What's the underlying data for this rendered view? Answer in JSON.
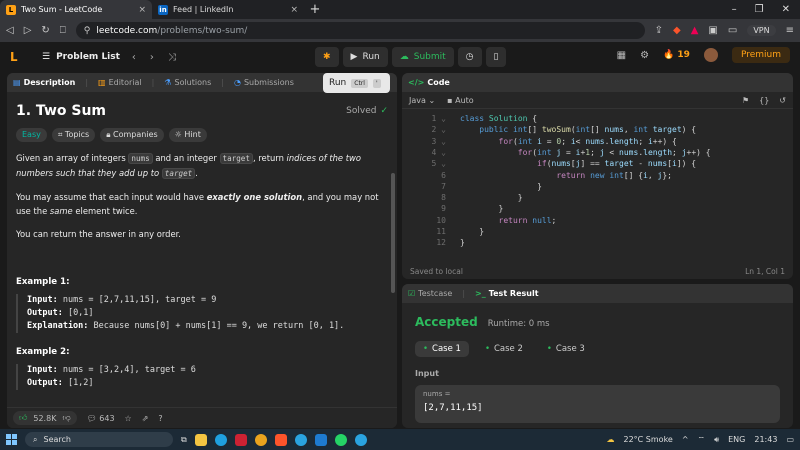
{
  "browser": {
    "tabs": [
      {
        "title": "Two Sum - LeetCode",
        "active": true
      },
      {
        "title": "Feed | LinkedIn",
        "active": false
      }
    ],
    "url_host": "leetcode.com",
    "url_path": "/problems/two-sum/",
    "vpn_label": "VPN"
  },
  "nav": {
    "problem_list": "Problem List",
    "run_label": "Run",
    "submit_label": "Submit",
    "streak": "19",
    "premium_label": "Premium"
  },
  "left_tabs": [
    "Description",
    "Editorial",
    "Solutions",
    "Submissions"
  ],
  "run_tooltip": {
    "label": "Run",
    "key1": "Ctrl",
    "key2": "'"
  },
  "problem": {
    "title": "1. Two Sum",
    "status": "Solved",
    "chips": [
      "Easy",
      "Topics",
      "Companies",
      "Hint"
    ],
    "para1_a": "Given an array of integers ",
    "para1_nums": "nums",
    "para1_b": " and an integer ",
    "para1_target": "target",
    "para1_c": ", return ",
    "para1_d": "indices of the two numbers such that they add up to",
    "para1_target2": "target",
    "para1_e": ".",
    "para2_a": "You may assume that each input would have ",
    "para2_b": "exactly one solution",
    "para2_c": ", and you may not use the ",
    "para2_d": "same",
    "para2_e": " element twice.",
    "para3": "You can return the answer in any order.",
    "examples": [
      {
        "heading": "Example 1:",
        "input_label": "Input:",
        "input": " nums = [2,7,11,15], target = 9",
        "output_label": "Output:",
        "output": " [0,1]",
        "expl_label": "Explanation:",
        "expl": " Because nums[0] + nums[1] == 9, we return [0, 1]."
      },
      {
        "heading": "Example 2:",
        "input_label": "Input:",
        "input": " nums = [3,2,4], target = 6",
        "output_label": "Output:",
        "output": " [1,2]"
      }
    ],
    "likes": "52.8K",
    "comments": "643"
  },
  "code": {
    "tab_label": "Code",
    "language": "Java",
    "mode": "Auto",
    "lines": [
      "class Solution {",
      "    public int[] twoSum(int[] nums, int target) {",
      "        for(int i = 0; i< nums.length; i++) {",
      "            for(int j = i+1; j < nums.length; j++) {",
      "                if(nums[j] == target - nums[i]) {",
      "                    return new int[] {i, j};",
      "                }",
      "            }",
      "        }",
      "        return null;",
      "    }",
      "}"
    ],
    "saved_text": "Saved to local",
    "cursor_text": "Ln 1, Col 1"
  },
  "test": {
    "tab_testcase": "Testcase",
    "tab_result": "Test Result",
    "verdict": "Accepted",
    "runtime": "Runtime: 0 ms",
    "cases": [
      "Case 1",
      "Case 2",
      "Case 3"
    ],
    "input_label": "Input",
    "var_label": "nums =",
    "var_value": "[2,7,11,15]"
  },
  "taskbar": {
    "search": "Search",
    "weather": "22°C  Smoke",
    "lang": "ENG",
    "time": "21:43"
  },
  "colors": {
    "accent": "#ffa116",
    "success": "#2cbb5d",
    "easy": "#00b8a3"
  }
}
